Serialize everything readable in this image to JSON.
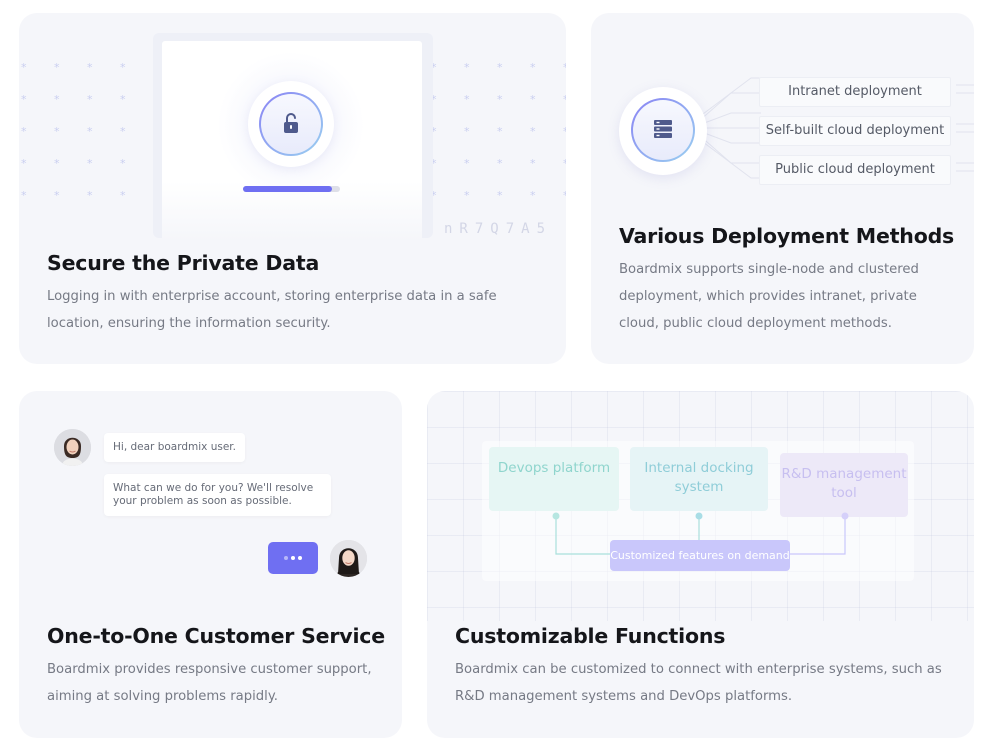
{
  "cards": {
    "secure": {
      "title": "Secure the Private Data",
      "description": "Logging in with enterprise account, storing enterprise data in a safe location, ensuring the information security.",
      "background_letters": "nR7Q7A5",
      "progress": 0.92,
      "icon": "unlock-icon",
      "dot_char": "* * * * * * * * * * * * * * * * * * * * * * * * * * * * * * * *"
    },
    "deployment": {
      "title": "Various Deployment Methods",
      "description": "Boardmix supports single-node and clustered deployment, which provides intranet, private cloud, public cloud deployment methods.",
      "icon": "server-icon",
      "options": [
        "Intranet deployment",
        "Self-built cloud deployment",
        "Public cloud deployment"
      ]
    },
    "service": {
      "title": "One-to-One Customer Service",
      "description": "Boardmix provides responsive customer support, aiming at solving problems rapidly.",
      "messages": [
        "Hi, dear boardmix user.",
        "What can we do for you? We'll resolve your problem as soon as possible."
      ]
    },
    "custom": {
      "title": "Customizable Functions",
      "description": "Boardmix can be customized to connect with enterprise systems, such as R&D management systems and DevOps platforms.",
      "systems": [
        "Devops platform",
        "Internal docking system",
        "R&D management tool"
      ],
      "center_label": "Customized features on demand"
    }
  },
  "colors": {
    "accent": "#6f6ff2",
    "card_bg": "#f5f6fa",
    "title": "#15161a",
    "text": "#767a85"
  }
}
